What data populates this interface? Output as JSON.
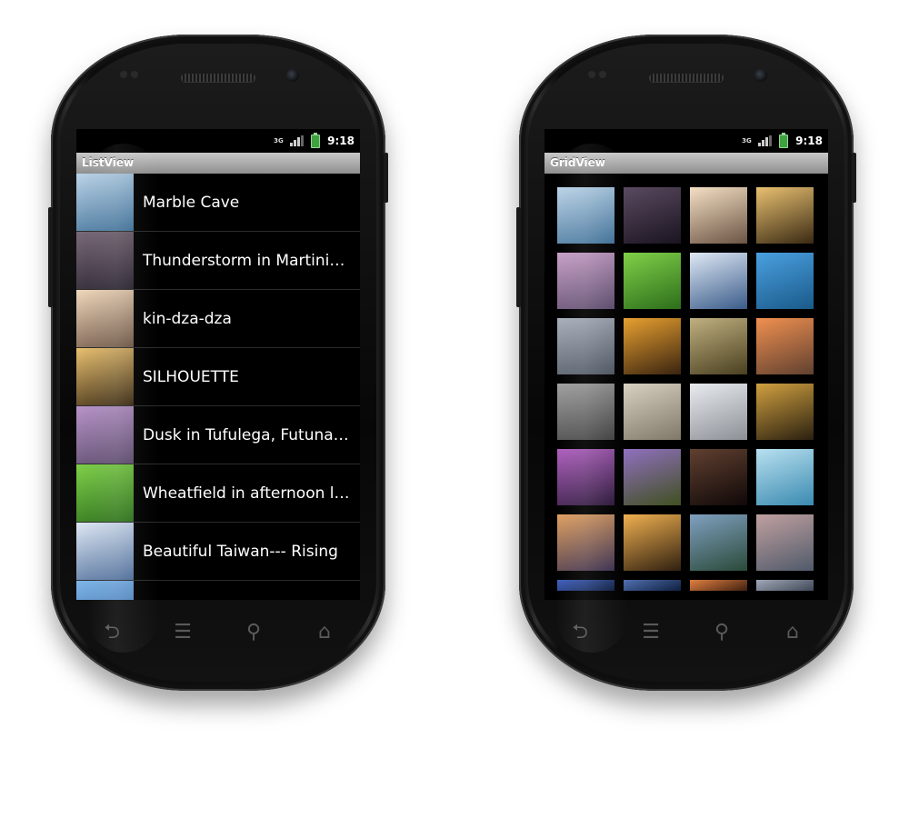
{
  "status": {
    "network": "3G",
    "time": "9:18"
  },
  "list_screen": {
    "title": "ListView",
    "items": [
      {
        "label": "Marble Cave",
        "c1": "#bcd4e8",
        "c2": "#3f6f96"
      },
      {
        "label": "Thunderstorm in Martinique",
        "c1": "#7a6a78",
        "c2": "#2a2430"
      },
      {
        "label": "kin-dza-dza",
        "c1": "#f0d8bc",
        "c2": "#6b5444"
      },
      {
        "label": "SILHOUETTE",
        "c1": "#e8c070",
        "c2": "#3a2a14"
      },
      {
        "label": "Dusk in Tufulega, Futuna Is...",
        "c1": "#b894c8",
        "c2": "#5a4a6a"
      },
      {
        "label": "Wheatfield in afternoon light",
        "c1": "#7fd04a",
        "c2": "#2d6e1c"
      },
      {
        "label": " Beautiful Taiwan--- Rising",
        "c1": "#dfe8f4",
        "c2": "#4d6c98"
      },
      {
        "label": "",
        "c1": "#7fb6e8",
        "c2": "#2e5c9a"
      }
    ]
  },
  "grid_screen": {
    "title": "GridView",
    "cells": [
      {
        "c1": "#bcd4e8",
        "c2": "#3f6f96"
      },
      {
        "c1": "#5a4a60",
        "c2": "#1a1420"
      },
      {
        "c1": "#f4e0c4",
        "c2": "#6b5444"
      },
      {
        "c1": "#e8c070",
        "c2": "#3a2a14"
      },
      {
        "c1": "#c8a0c8",
        "c2": "#5a4a6a"
      },
      {
        "c1": "#80d048",
        "c2": "#2d6e1c"
      },
      {
        "c1": "#dfe8f4",
        "c2": "#3a5c8a"
      },
      {
        "c1": "#4aa0e0",
        "c2": "#1a5a8a"
      },
      {
        "c1": "#a8b0bc",
        "c2": "#4c5460"
      },
      {
        "c1": "#e8a030",
        "c2": "#3a2410"
      },
      {
        "c1": "#c0b080",
        "c2": "#4a4020"
      },
      {
        "c1": "#f09050",
        "c2": "#604030"
      },
      {
        "c1": "#a0a0a0",
        "c2": "#404040"
      },
      {
        "c1": "#d8d0c0",
        "c2": "#807868"
      },
      {
        "c1": "#e8ecf0",
        "c2": "#8c9096"
      },
      {
        "c1": "#d0a040",
        "c2": "#2a2010"
      },
      {
        "c1": "#b060c0",
        "c2": "#2a1838"
      },
      {
        "c1": "#9070c0",
        "c2": "#405020"
      },
      {
        "c1": "#604030",
        "c2": "#100808"
      },
      {
        "c1": "#b8e0f0",
        "c2": "#3a8ab0"
      },
      {
        "c1": "#e0a060",
        "c2": "#3a3050"
      },
      {
        "c1": "#f0b050",
        "c2": "#302010"
      },
      {
        "c1": "#80a0c0",
        "c2": "#2a4a3a"
      },
      {
        "c1": "#c0a0a0",
        "c2": "#505a6a"
      },
      {
        "c1": "#4060c0",
        "c2": "#102040"
      },
      {
        "c1": "#5070b0",
        "c2": "#102040"
      },
      {
        "c1": "#e08040",
        "c2": "#402010"
      },
      {
        "c1": "#a0a8b8",
        "c2": "#404858"
      }
    ]
  },
  "nav": {
    "back": "⮌",
    "menu": "☰",
    "search": "⚲",
    "home": "⌂"
  }
}
